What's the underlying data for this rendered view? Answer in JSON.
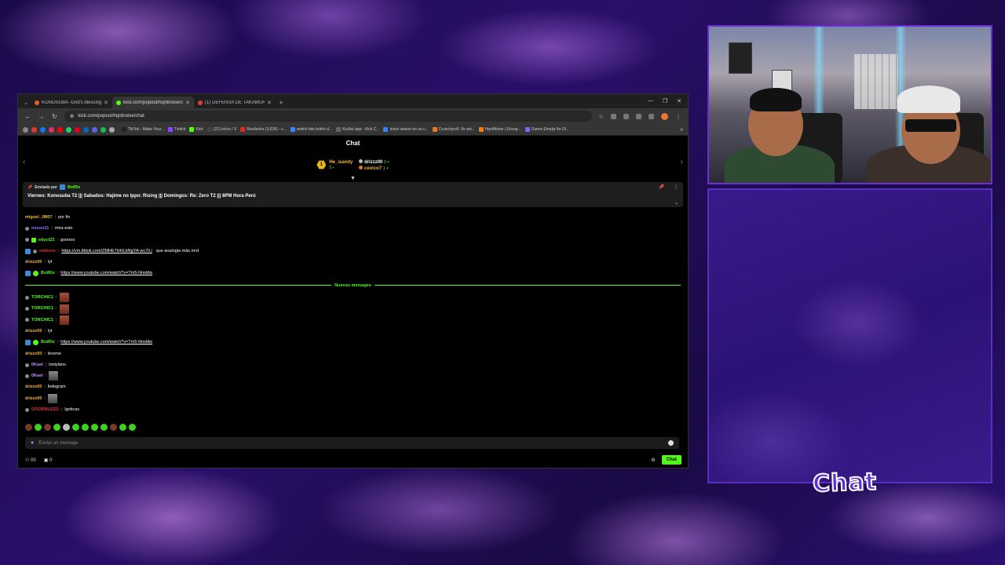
{
  "browser": {
    "tabs": [
      {
        "title": "KONOSUBA -God's blessing on...",
        "favicon_color": "#e95e2a",
        "active": false
      },
      {
        "title": "kick.com/popout/hqrdnoise/ch...",
        "favicon_color": "#53fc18",
        "active": true
      },
      {
        "title": "(1) DEFENSA DE TAKAMURA -...",
        "favicon_color": "#e53935",
        "active": false
      }
    ],
    "url": "kick.com/popout/hqrdnoise/chat",
    "bookmarks": [
      {
        "label": "TikTok - Make Your...",
        "color": "#222"
      },
      {
        "label": "Twitch",
        "color": "#9146ff"
      },
      {
        "label": "Kick",
        "color": "#53fc18"
      },
      {
        "label": "(21) Inicio / X",
        "color": "#444"
      },
      {
        "label": "Recibidos (3,628) - c...",
        "color": "#d93025"
      },
      {
        "label": "switch bits botón d...",
        "color": "#4285f4"
      },
      {
        "label": "Kicklet.app - Kick C...",
        "color": "#666"
      },
      {
        "label": "Inicie sesión en su c...",
        "color": "#3b82f6"
      },
      {
        "label": "Crunchyroll: Ve ani...",
        "color": "#f47521"
      },
      {
        "label": "HqrdNoise | Group...",
        "color": "#e67e22"
      },
      {
        "label": "Dance Emojis for Di...",
        "color": "#7b68ee"
      }
    ]
  },
  "chat": {
    "header": "Chat",
    "gifters": {
      "top": {
        "name": "He_isandy",
        "count": "5",
        "rank": "1"
      },
      "others": [
        {
          "name": "drizzz00",
          "count": "3"
        },
        {
          "name": "cevico7",
          "count": "1"
        }
      ]
    },
    "pinned": {
      "sent_by_label": "Enviado por",
      "sender": "BotRix",
      "text": "Viernes: Konosuba T2 ||| Sabados: Hajime no Ippo: Rising ||| Domingos: Re: Zero T2 ||| 8PM Hora Perú"
    },
    "messages_before": [
      {
        "user": "miguel_JM07",
        "color": "#f5b73b",
        "text": "por fin",
        "badges": []
      },
      {
        "user": "nexon21",
        "color": "#9b6cff",
        "text": "mira esto",
        "badges": [
          "dot"
        ]
      },
      {
        "user": "edyct23",
        "color": "#53fc18",
        "text": "gooooo",
        "badges": [
          "dot",
          "sq"
        ]
      },
      {
        "user": "mdmsiv",
        "color": "#e0312e",
        "text": "https://vm.tiktok.com/ZMHE7HHLbNgYA-wc7iL/",
        "suffix": " que analogia más mrd",
        "link": true,
        "badges": [
          "bot",
          "dot"
        ]
      },
      {
        "user": "drizzz00",
        "color": "#f5b73b",
        "text": "lyt",
        "badges": []
      },
      {
        "user": "BotRix",
        "color": "#53fc18",
        "text": "https://www.youtube.com/watch?v=Tm5-Nnsldis",
        "link": true,
        "badges": [
          "bot",
          "ver"
        ]
      }
    ],
    "new_messages_label": "Nuevos mensajes",
    "messages_after": [
      {
        "user": "TORCHIC1",
        "color": "#53fc18",
        "text": "",
        "emote": true,
        "badges": [
          "dot"
        ]
      },
      {
        "user": "TORCHIC1",
        "color": "#53fc18",
        "text": "",
        "emote": true,
        "badges": [
          "dot"
        ]
      },
      {
        "user": "TORCHIC1",
        "color": "#53fc18",
        "text": "",
        "emote": true,
        "badges": [
          "dot"
        ]
      },
      {
        "user": "drizzz00",
        "color": "#f5b73b",
        "text": "lyt",
        "badges": []
      },
      {
        "user": "BotRix",
        "color": "#53fc18",
        "text": "https://www.youtube.com/watch?v=Tm5-Nnsldis",
        "link": true,
        "badges": [
          "bot",
          "ver"
        ]
      },
      {
        "user": "drizzz00",
        "color": "#f5b73b",
        "text": "lerome",
        "badges": []
      },
      {
        "user": "0Kael",
        "color": "#c08bff",
        "text": "lonlyfans",
        "badges": [
          "dot"
        ]
      },
      {
        "user": "0Kael",
        "color": "#c08bff",
        "text": "",
        "emote": true,
        "emote_gray": true,
        "badges": [
          "dot"
        ]
      },
      {
        "user": "drizzz00",
        "color": "#f5b73b",
        "text": "ltelegram",
        "badges": []
      },
      {
        "user": "drizzz00",
        "color": "#f5b73b",
        "text": "",
        "emote": true,
        "emote_gray": true,
        "badges": []
      },
      {
        "user": "DOORNLESS",
        "color": "#e0312e",
        "text": "lgoticas",
        "badges": [
          "dot"
        ]
      }
    ],
    "input_placeholder": "Enviar un mensaje",
    "viewers": "00",
    "points": "0",
    "send_label": "Chat"
  },
  "overlay": {
    "chat_label": "Chat"
  }
}
